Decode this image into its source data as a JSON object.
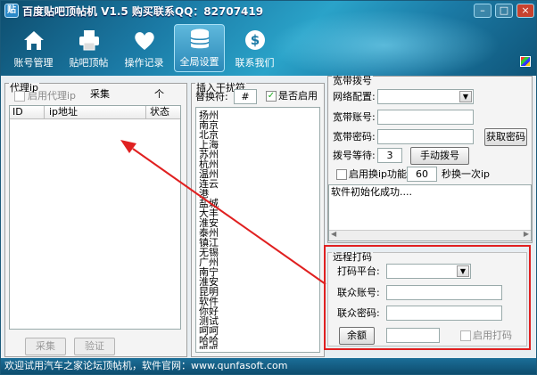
{
  "window": {
    "title": "百度贴吧顶帖机 V1.5 购买联系QQ：82707419",
    "app_icon": "贴"
  },
  "nav": [
    {
      "label": "账号管理",
      "icon": "home-icon"
    },
    {
      "label": "贴吧顶帖",
      "icon": "printer-icon"
    },
    {
      "label": "操作记录",
      "icon": "heart-icon"
    },
    {
      "label": "全局设置",
      "icon": "database-icon",
      "active": true
    },
    {
      "label": "联系我们",
      "icon": "dollar-icon"
    }
  ],
  "proxy": {
    "legend": "代理ip",
    "enable_label": "启用代理ip",
    "collect_label": "采集",
    "unit": "个",
    "col_id": "ID",
    "col_ip": "ip地址",
    "col_status": "状态",
    "collect_btn": "采集",
    "verify_btn": "验证"
  },
  "interference": {
    "legend": "插入干扰符",
    "replace_label": "替换符:",
    "replace_value": "#",
    "enable_label": "是否启用",
    "text": "扬州\n南京\n北京\n上海\n苏州\n杭州\n温州\n连云港\n盐城\n大丰\n淮安\n泰州\n镇江\n无锡\n广州\n南宁\n淮安\n昆明\n软件\n你好\n测试\n呵呵\n哈哈\n呱呱\n北京市\n东城区\n西城区"
  },
  "dialup": {
    "legend": "宽带拨号",
    "config_label": "网络配置:",
    "account_label": "宽带账号:",
    "password_label": "宽带密码:",
    "get_password_btn": "获取密码",
    "wait_label": "拨号等待:",
    "wait_value": "3",
    "manual_btn": "手动拨号",
    "switch_label": "启用换ip功能",
    "switch_value": "60",
    "switch_suffix": "秒换一次ip",
    "log": "软件初始化成功...."
  },
  "captcha": {
    "legend": "远程打码",
    "platform_label": "打码平台:",
    "account_label": "联众账号:",
    "password_label": "联众密码:",
    "balance_btn": "余额",
    "enable_label": "启用打码"
  },
  "status": "欢迎试用汽车之家论坛顶帖机，软件官网：www.qunfasoft.com",
  "colors": {
    "accent": "#1b7aa5",
    "highlight_box": "#e02020",
    "arrow": "#e02020"
  }
}
